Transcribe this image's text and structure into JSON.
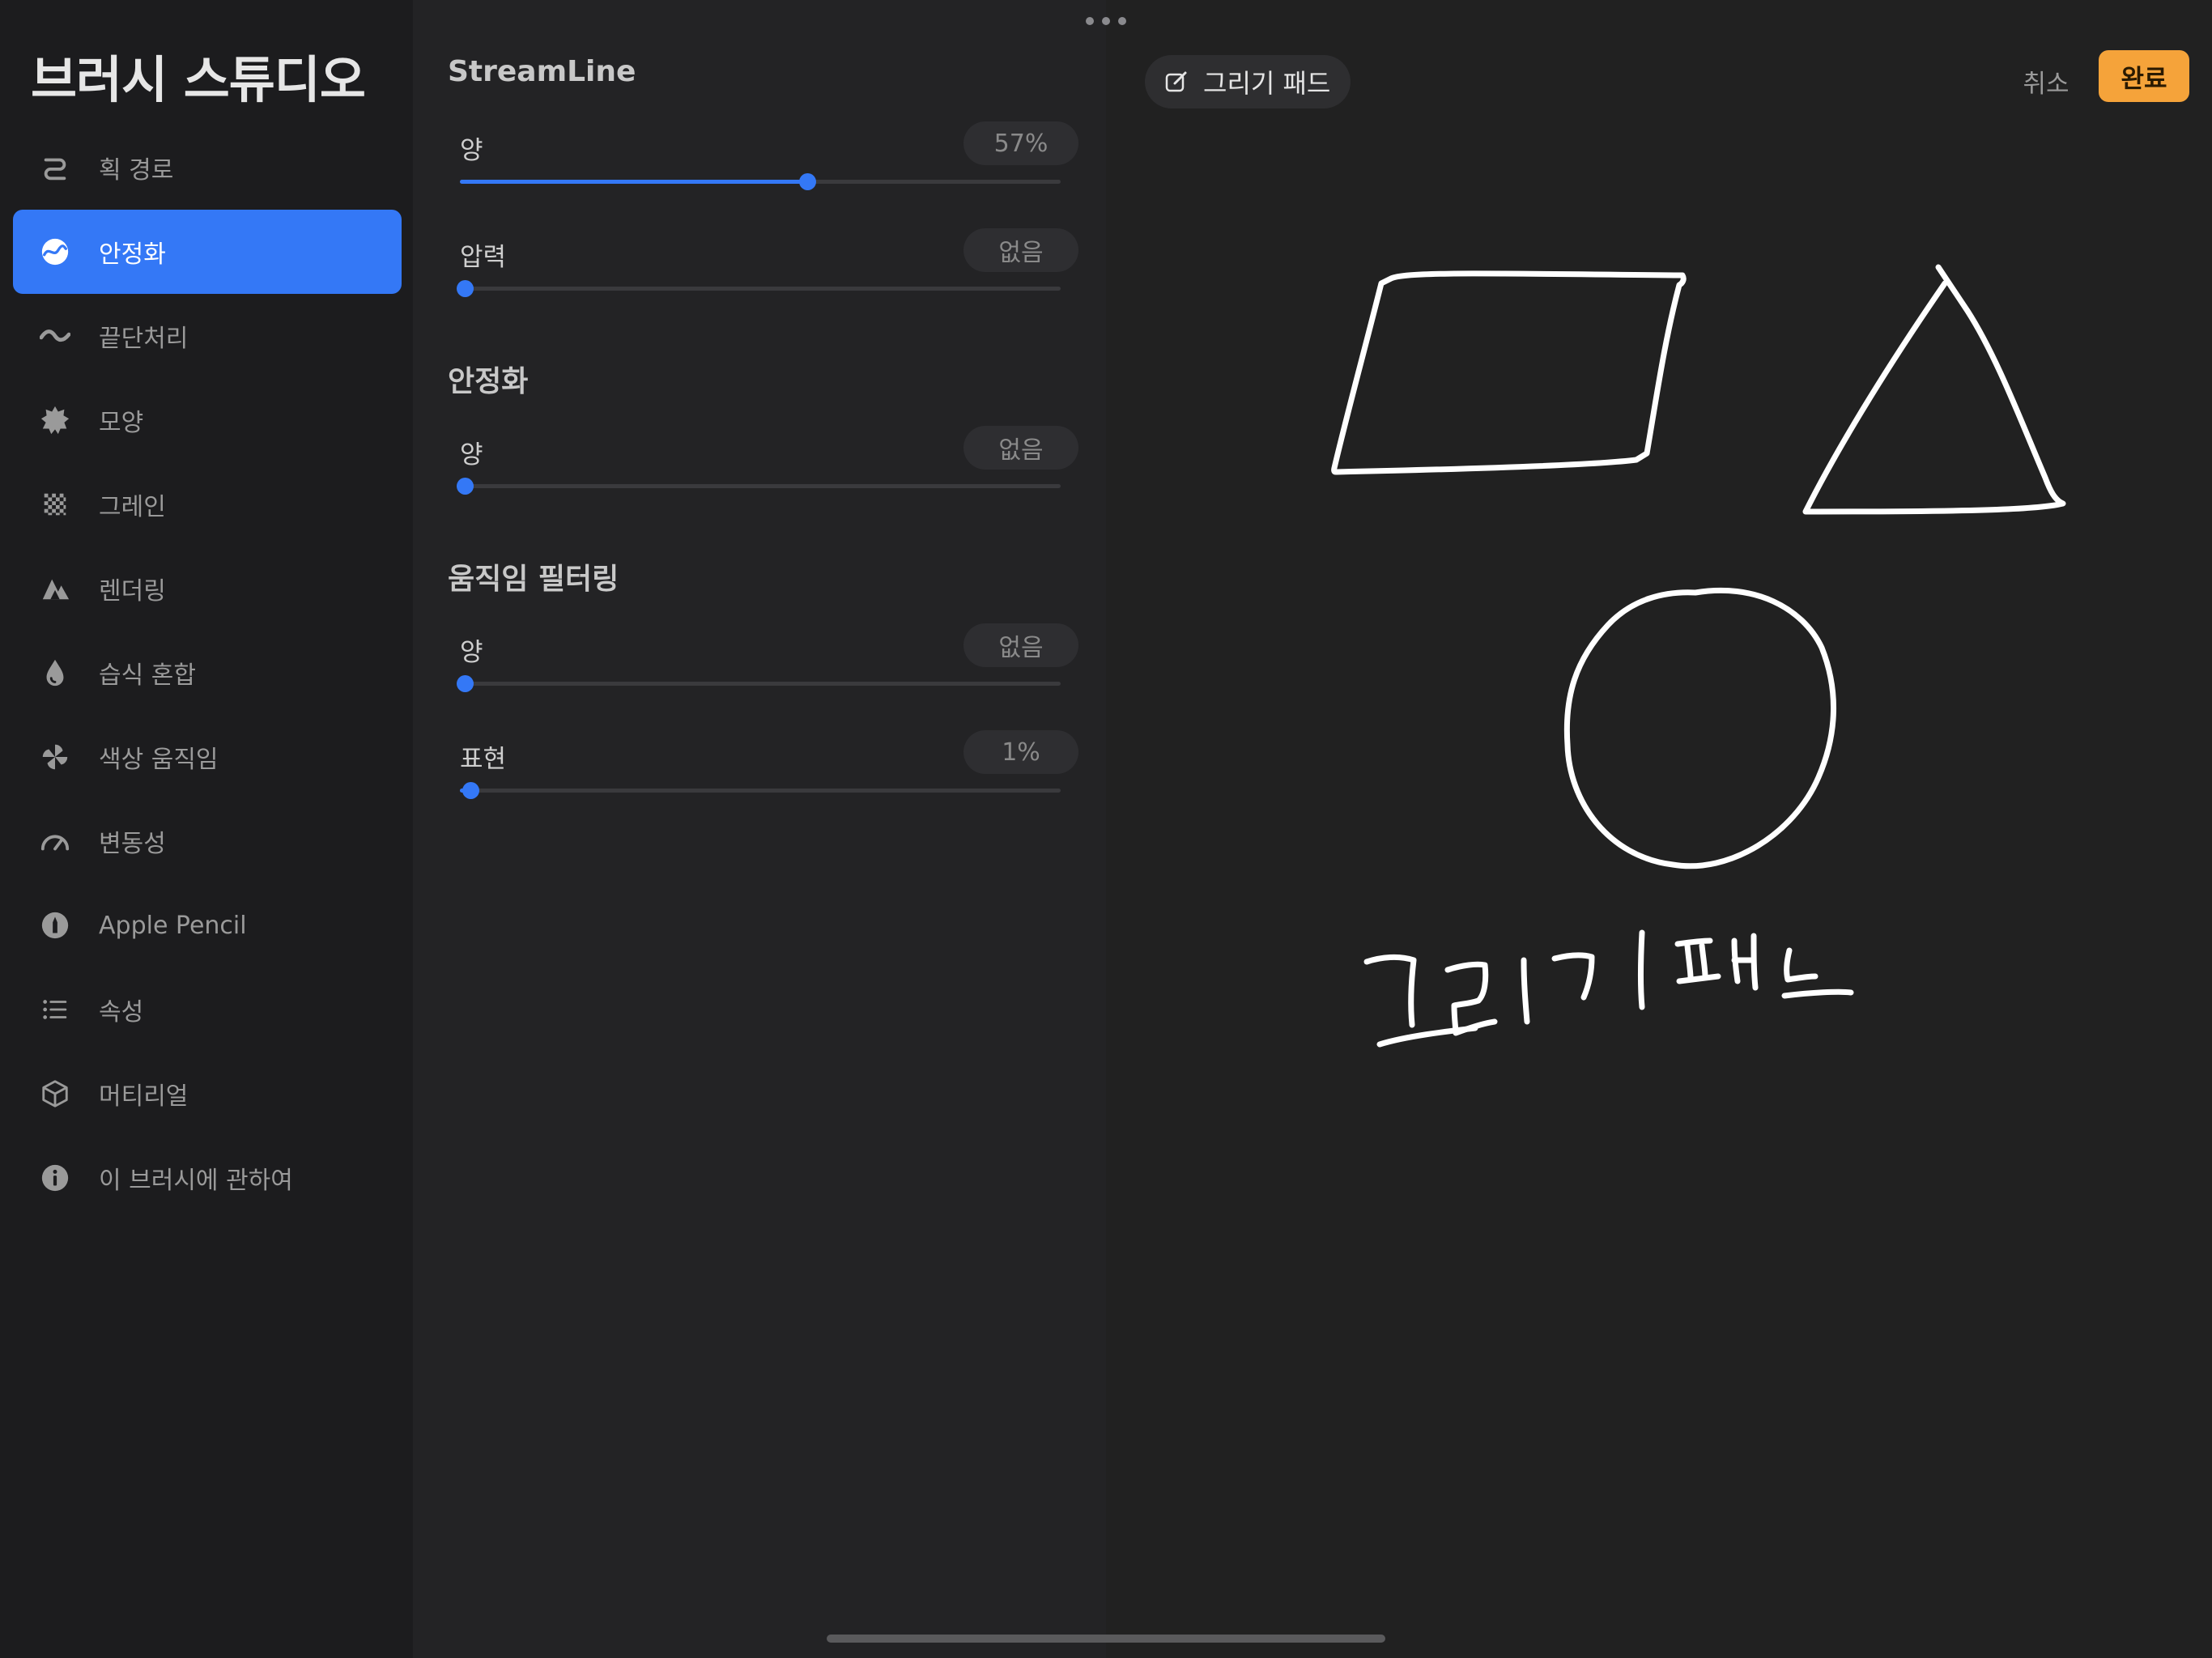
{
  "sidebar": {
    "title": "브러시 스튜디오",
    "items": [
      {
        "label": "획 경로",
        "icon": "stroke-path-icon",
        "active": false
      },
      {
        "label": "안정화",
        "icon": "stabilization-icon",
        "active": true
      },
      {
        "label": "끝단처리",
        "icon": "taper-icon",
        "active": false
      },
      {
        "label": "모양",
        "icon": "shape-icon",
        "active": false
      },
      {
        "label": "그레인",
        "icon": "grain-icon",
        "active": false
      },
      {
        "label": "렌더링",
        "icon": "rendering-icon",
        "active": false
      },
      {
        "label": "습식 혼합",
        "icon": "wet-mix-icon",
        "active": false
      },
      {
        "label": "색상 움직임",
        "icon": "color-dynamics-icon",
        "active": false
      },
      {
        "label": "변동성",
        "icon": "dynamics-gauge-icon",
        "active": false
      },
      {
        "label": "Apple Pencil",
        "icon": "apple-pencil-icon",
        "active": false
      },
      {
        "label": "속성",
        "icon": "properties-list-icon",
        "active": false
      },
      {
        "label": "머티리얼",
        "icon": "materials-cube-icon",
        "active": false
      },
      {
        "label": "이 브러시에 관하여",
        "icon": "info-icon",
        "active": false
      }
    ]
  },
  "settings": {
    "streamline": {
      "title": "StreamLine",
      "amount": {
        "label": "양",
        "value": "57%",
        "fraction": 0.57
      },
      "pressure": {
        "label": "압력",
        "value": "없음",
        "fraction": 0.0
      }
    },
    "stabilization": {
      "title": "안정화",
      "amount": {
        "label": "양",
        "value": "없음",
        "fraction": 0.0
      }
    },
    "motion_filtering": {
      "title": "움직임 필터링",
      "amount": {
        "label": "양",
        "value": "없음",
        "fraction": 0.0
      },
      "expression": {
        "label": "표현",
        "value": "1%",
        "fraction": 0.01
      }
    }
  },
  "pad": {
    "title": "그리기 패드",
    "cancel_label": "취소",
    "done_label": "완료",
    "accent_color": "#f5a33a",
    "handwriting": "그리기 패드"
  },
  "colors": {
    "active_blue": "#3478f6",
    "background": "#1c1c1e"
  }
}
